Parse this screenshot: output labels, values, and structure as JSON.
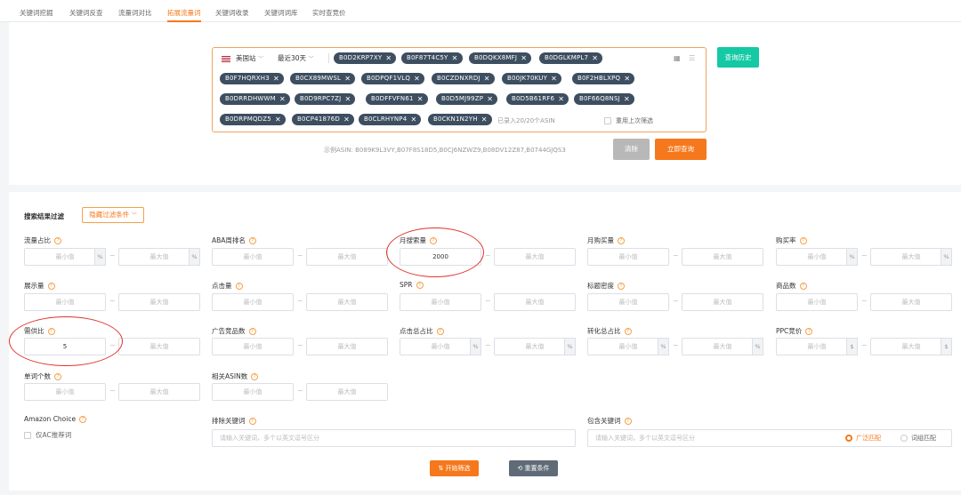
{
  "tabs": [
    "关键词挖掘",
    "关键词反查",
    "流量词对比",
    "拓展流量词",
    "关键词收录",
    "关键词词库",
    "实时查竞价"
  ],
  "active_tab": "拓展流量词",
  "search": {
    "marketplace": "美国站",
    "period": "最近30天",
    "asins": [
      "B0D2KRP7XY",
      "B0F87T4C5Y",
      "B0DQKX8MFJ",
      "B0DGLKMPL7",
      "B0F7HQRXH3",
      "B0CX89MWSL",
      "B0DPQF1VLQ",
      "B0CZDNXRDJ",
      "B00JK70KUY",
      "B0F2HBLXPQ",
      "B0DRRDHWWM",
      "B0D9RPC7ZJ",
      "B0DFFVFN61",
      "B0D5MJ99ZP",
      "B0D5B61RF6",
      "B0F66Q8NSJ",
      "B0DRPMQDZ5",
      "B0CP41876D",
      "B0CLRHYNP4",
      "B0CKN1N2YH"
    ],
    "count_text": "已录入20/20个ASIN",
    "reuse_label": "重用上次筛选",
    "history_btn": "查询历史",
    "example": "示例ASIN:  B089K9L3VY,B07F8S18D5,B0CJ6NZWZ9,B08DV12Z87,B0744GJQS3",
    "clear_btn": "清除",
    "query_btn": "立即查询",
    "remove_glyph": "✕"
  },
  "filter": {
    "title": "搜索结果过滤",
    "toggle": "隐藏过滤条件",
    "min_ph": "最小值",
    "max_ph": "最大值",
    "tilde": "~",
    "f1": "流量占比",
    "f1_unit": "%",
    "f2": "ABA周排名",
    "f3": "月搜索量",
    "f3_min": "2000",
    "f4": "月购买量",
    "f5": "购买率",
    "f5_unit": "%",
    "f6": "展示量",
    "f7": "点击量",
    "f8": "SPR",
    "f9": "标题密度",
    "f10": "商品数",
    "f11": "需供比",
    "f11_min": "5",
    "f12": "广告竞品数",
    "f13": "点击总占比",
    "f13_unit": "%",
    "f14": "转化总占比",
    "f14_unit": "%",
    "f15": "PPC竞价",
    "f15_unit": "$",
    "f16": "单词个数",
    "f17": "相关ASIN数",
    "ac_title": "Amazon Choice",
    "ac_only": "仅AC推荐词",
    "exclude_title": "排除关键词",
    "exclude_ph": "请输入关键词，多个以英文逗号区分",
    "include_title": "包含关键词",
    "include_ph": "请输入关键词，多个以英文逗号区分",
    "broad": "广泛匹配",
    "phrase": "词组匹配",
    "start_btn": "开始筛选",
    "reset_btn": "重置条件"
  },
  "colors": {
    "accent": "#f5781c",
    "history": "#14c9a4",
    "chip": "#3d4e60",
    "annotation": "#e0312b"
  }
}
